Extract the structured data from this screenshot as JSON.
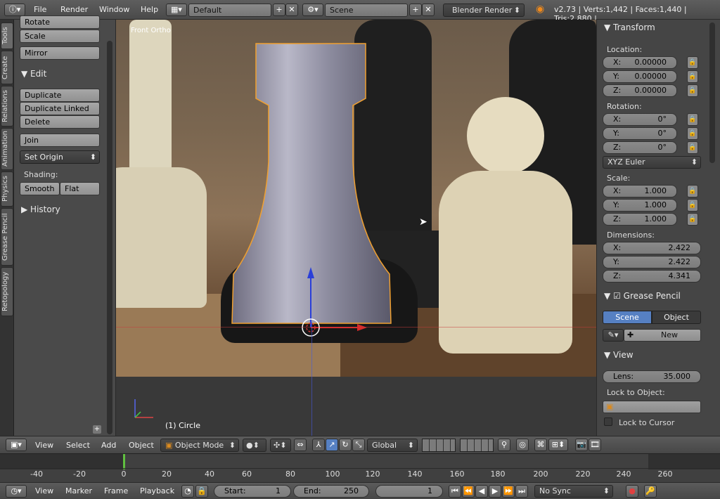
{
  "topbar": {
    "menus": [
      "File",
      "Render",
      "Window",
      "Help"
    ],
    "layout_name": "Default",
    "scene_name": "Scene",
    "render_engine": "Blender Render",
    "stats": "v2.73 | Verts:1,442 | Faces:1,440 | Tris:2,880 |"
  },
  "viewport": {
    "view_label": "Front Ortho",
    "object_label": "(1) Circle"
  },
  "tool_tabs": [
    "Tools",
    "Create",
    "Relations",
    "Animation",
    "Physics",
    "Grease Pencil",
    "Retopology"
  ],
  "tool_shelf": {
    "rotate": "Rotate",
    "scale": "Scale",
    "mirror": "Mirror",
    "edit_header": "Edit",
    "duplicate": "Duplicate",
    "duplicate_linked": "Duplicate Linked",
    "delete": "Delete",
    "join": "Join",
    "set_origin": "Set Origin",
    "shading_label": "Shading:",
    "smooth": "Smooth",
    "flat": "Flat",
    "history_header": "History"
  },
  "properties": {
    "transform_header": "Transform",
    "location_label": "Location:",
    "location": [
      {
        "k": "X:",
        "v": "0.00000"
      },
      {
        "k": "Y:",
        "v": "0.00000"
      },
      {
        "k": "Z:",
        "v": "0.00000"
      }
    ],
    "rotation_label": "Rotation:",
    "rotation": [
      {
        "k": "X:",
        "v": "0°"
      },
      {
        "k": "Y:",
        "v": "0°"
      },
      {
        "k": "Z:",
        "v": "0°"
      }
    ],
    "rotation_mode": "XYZ Euler",
    "scale_label": "Scale:",
    "scale": [
      {
        "k": "X:",
        "v": "1.000"
      },
      {
        "k": "Y:",
        "v": "1.000"
      },
      {
        "k": "Z:",
        "v": "1.000"
      }
    ],
    "dimensions_label": "Dimensions:",
    "dimensions": [
      {
        "k": "X:",
        "v": "2.422"
      },
      {
        "k": "Y:",
        "v": "2.422"
      },
      {
        "k": "Z:",
        "v": "4.341"
      }
    ],
    "grease_header": "Grease Pencil",
    "scene_tab": "Scene",
    "object_tab": "Object",
    "new_label": "New",
    "view_header": "View",
    "lens_label": "Lens:",
    "lens_value": "35.000",
    "lock_object_label": "Lock to Object:",
    "lock_cursor_label": "Lock to Cursor"
  },
  "viewport_header": {
    "menus": [
      "View",
      "Select",
      "Add",
      "Object"
    ],
    "mode": "Object Mode",
    "orientation": "Global"
  },
  "timeline": {
    "ticks": [
      "-40",
      "-20",
      "0",
      "20",
      "40",
      "60",
      "80",
      "100",
      "120",
      "140",
      "160",
      "180",
      "200",
      "220",
      "240",
      "260"
    ]
  },
  "timeline_header": {
    "menus": [
      "View",
      "Marker",
      "Frame",
      "Playback"
    ],
    "start_label": "Start:",
    "start_value": "1",
    "end_label": "End:",
    "end_value": "250",
    "current_frame": "1",
    "sync": "No Sync"
  },
  "colors": {
    "accent_blue": "#5680c2",
    "selection_orange": "#f0a030",
    "timeline_cursor": "#60c040"
  }
}
